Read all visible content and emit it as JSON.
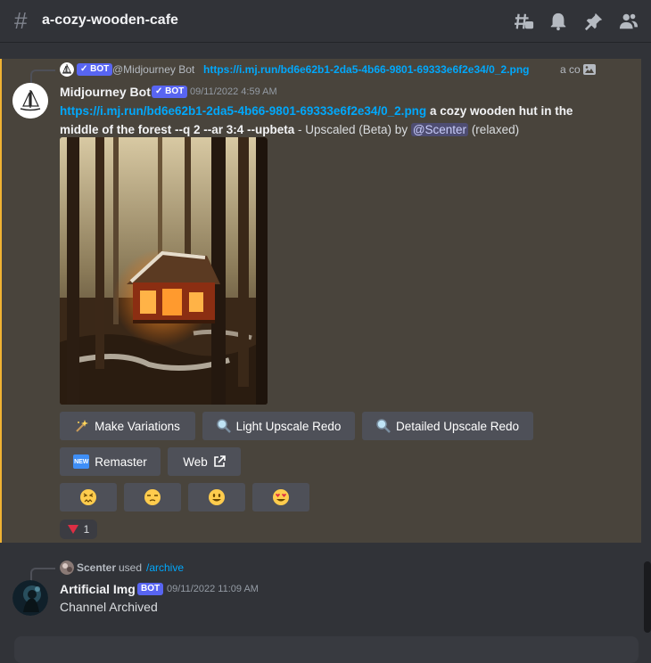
{
  "header": {
    "channel_name": "a-cozy-wooden-cafe"
  },
  "message1": {
    "reply": {
      "bot_tag": "BOT",
      "author": "@Midjourney Bot",
      "link": "https://i.mj.run/bd6e62b1-2da5-4b66-9801-69333e6f2e34/0_2.png",
      "trail": "a co"
    },
    "author": "Midjourney Bot",
    "bot_tag": "BOT",
    "timestamp": "09/11/2022 4:59 AM",
    "link": "https://i.mj.run/bd6e62b1-2da5-4b66-9801-69333e6f2e34/0_2.png",
    "prompt": " a cozy wooden hut in the middle of the forest --q 2 --ar 3:4 --upbeta",
    "suffix": " - Upscaled (Beta) by ",
    "mention": "@Scenter",
    "status": " (relaxed)",
    "buttons": {
      "make_variations": "Make Variations",
      "light_upscale": "Light Upscale Redo",
      "detailed_upscale": "Detailed Upscale Redo",
      "remaster": "Remaster",
      "web": "Web",
      "new_badge": "NEW"
    },
    "reaction": {
      "count": "1"
    }
  },
  "message2": {
    "reply": {
      "user": "Scenter",
      "used": "used",
      "command": "/archive"
    },
    "author": "Artificial Img",
    "bot_tag": "BOT",
    "timestamp": "09/11/2022 11:09 AM",
    "content": "Channel Archived"
  },
  "colors": {
    "background": "#313338",
    "highlight": "#49443c",
    "highlight_border": "#f0b232",
    "link": "#00a8fc",
    "bot_tag": "#5865f2",
    "button": "#4e5058"
  },
  "icons": [
    "hash-icon",
    "threads-icon",
    "bell-icon",
    "pin-icon",
    "members-icon",
    "image-icon",
    "sparkles-icon",
    "magnifier-icon",
    "new-badge-icon",
    "external-link-icon",
    "confounded-face-icon",
    "unamused-face-icon",
    "smiley-face-icon",
    "heart-eyes-face-icon",
    "red-triangle-icon"
  ]
}
